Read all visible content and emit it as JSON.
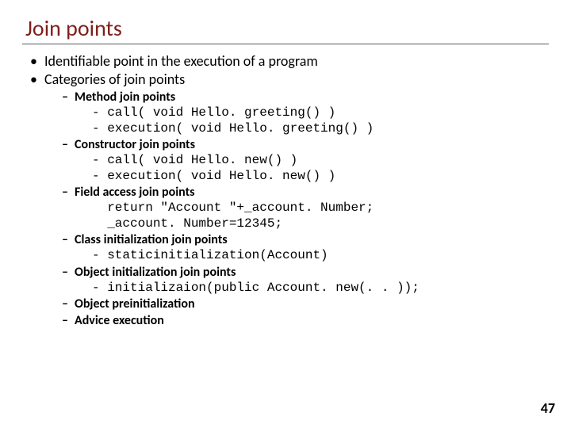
{
  "title": "Join points",
  "bullets": {
    "b1": "Identifiable point in the execution of a program",
    "b2": "Categories of join points"
  },
  "sub": {
    "method": {
      "label": "Method join points",
      "code1": "- call( void Hello. greeting() )",
      "code2": "- execution( void Hello. greeting() )"
    },
    "ctor": {
      "label": "Constructor join points",
      "code1": "- call( void Hello. new() )",
      "code2": "- execution( void Hello. new() )"
    },
    "field": {
      "label": "Field access join points",
      "code1": "  return \"Account \"+_account. Number;",
      "code2": "  _account. Number=12345;"
    },
    "classinit": {
      "label": "Class initialization join points",
      "code1": "- staticinitialization(Account)"
    },
    "objinit": {
      "label": "Object initialization join points",
      "code1": "- initializaion(public Account. new(. . ));"
    },
    "preinit": {
      "label": "Object preinitialization"
    },
    "advice": {
      "label": "Advice execution"
    }
  },
  "page_number": "47"
}
